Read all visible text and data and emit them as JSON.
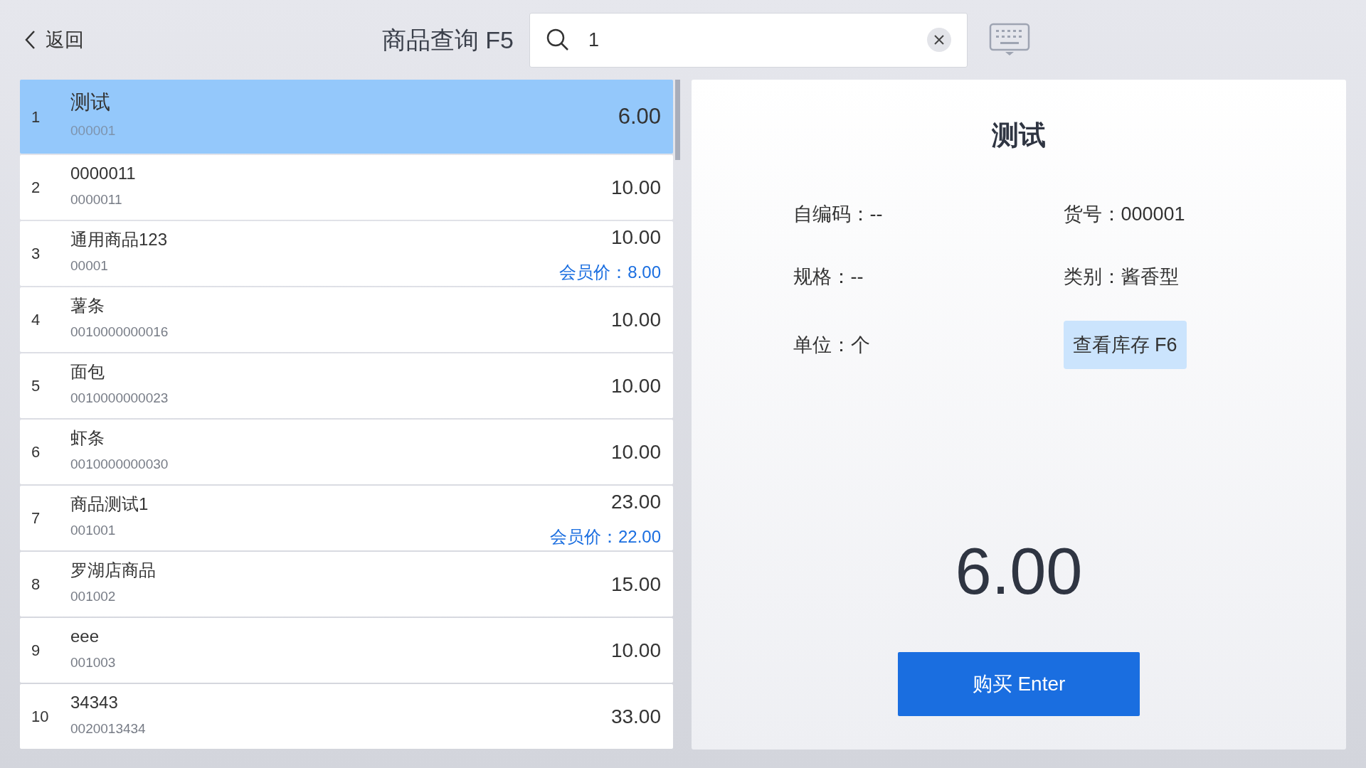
{
  "header": {
    "back": "返回",
    "title": "商品查询 F5",
    "search": {
      "value": "1"
    }
  },
  "products": [
    {
      "index": "1",
      "name": "测试",
      "code": "000001",
      "price": "6.00",
      "selected": true
    },
    {
      "index": "2",
      "name": "0000011",
      "code": "0000011",
      "price": "10.00",
      "selected": false
    },
    {
      "index": "3",
      "name": "通用商品123",
      "code": "00001",
      "price": "10.00",
      "member_price": "会员价：8.00",
      "selected": false
    },
    {
      "index": "4",
      "name": "薯条",
      "code": "0010000000016",
      "price": "10.00",
      "selected": false
    },
    {
      "index": "5",
      "name": "面包",
      "code": "0010000000023",
      "price": "10.00",
      "selected": false
    },
    {
      "index": "6",
      "name": "虾条",
      "code": "0010000000030",
      "price": "10.00",
      "selected": false
    },
    {
      "index": "7",
      "name": "商品测试1",
      "code": "001001",
      "price": "23.00",
      "member_price": "会员价：22.00",
      "selected": false
    },
    {
      "index": "8",
      "name": "罗湖店商品",
      "code": "001002",
      "price": "15.00",
      "selected": false
    },
    {
      "index": "9",
      "name": "eee",
      "code": "001003",
      "price": "10.00",
      "selected": false
    },
    {
      "index": "10",
      "name": "34343",
      "code": "0020013434",
      "price": "33.00",
      "selected": false
    }
  ],
  "detail": {
    "name": "测试",
    "fields": [
      {
        "kind": "text",
        "label": "自编码：--"
      },
      {
        "kind": "text",
        "label": "货号：000001"
      },
      {
        "kind": "text",
        "label": "规格：--"
      },
      {
        "kind": "text",
        "label": "类别：酱香型"
      },
      {
        "kind": "text",
        "label": "单位：个"
      },
      {
        "kind": "button",
        "label": "查看库存 F6"
      }
    ],
    "price": "6.00",
    "buy_button": "购买 Enter"
  }
}
